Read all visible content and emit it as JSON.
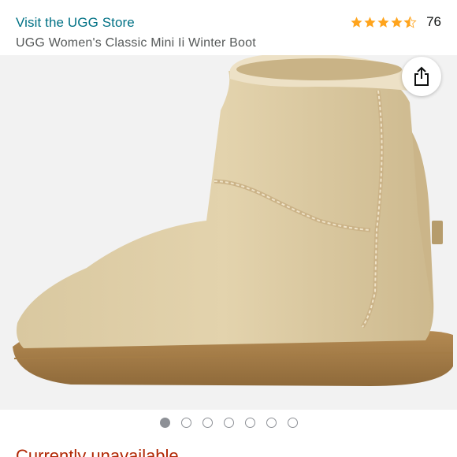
{
  "header": {
    "store_link": "Visit the UGG Store",
    "rating_value": 4.5,
    "rating_count": "76",
    "star_color": "#ffa41c"
  },
  "product": {
    "title": "UGG Women's Classic Mini Ii Winter Boot",
    "image_icon": "boot-image"
  },
  "share": {
    "icon": "share-icon"
  },
  "carousel": {
    "dot_count": 7,
    "active_index": 0
  },
  "availability": {
    "text": "Currently unavailable",
    "color": "#b12704"
  }
}
